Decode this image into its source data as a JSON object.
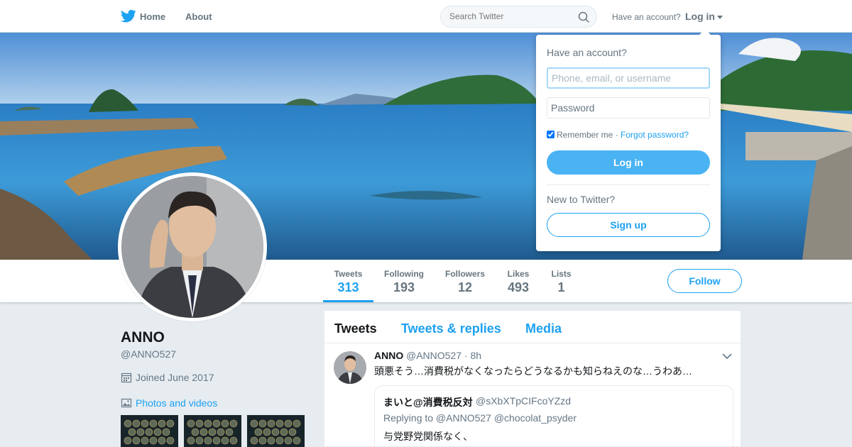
{
  "nav": {
    "home_label": "Home",
    "about_label": "About",
    "search_placeholder": "Search Twitter",
    "have_account": "Have an account?",
    "login_label": "Log in"
  },
  "profile": {
    "name": "ANNO",
    "handle": "@ANNO527",
    "joined": "Joined June 2017",
    "photos_link": "Photos and videos",
    "follow_label": "Follow",
    "stats": [
      {
        "label": "Tweets",
        "value": "313"
      },
      {
        "label": "Following",
        "value": "193"
      },
      {
        "label": "Followers",
        "value": "12"
      },
      {
        "label": "Likes",
        "value": "493"
      },
      {
        "label": "Lists",
        "value": "1"
      }
    ]
  },
  "timeline": {
    "tabs": [
      "Tweets",
      "Tweets & replies",
      "Media"
    ],
    "tweet": {
      "name": "ANNO",
      "meta": "@ANNO527 · 8h",
      "text": "頭悪そう…消費税がなくなったらどうなるかも知らねえのな…うわあ…",
      "quote": {
        "name": "まいと@消費税反対",
        "handle": "@sXbXTpCIFcoYZzd",
        "reply": "Replying to @ANNO527 @chocolat_psyder",
        "text": "与党野党関係なく、"
      }
    }
  },
  "login_dropdown": {
    "title": "Have an account?",
    "username_placeholder": "Phone, email, or username",
    "password_placeholder": "Password",
    "remember": "Remember me",
    "separator": " · ",
    "forgot": "Forgot password?",
    "login_button": "Log in",
    "new_user": "New to Twitter?",
    "signup_button": "Sign up"
  },
  "colors": {
    "brand": "#1da1f2",
    "muted": "#66757f",
    "background": "#e6ecf0"
  }
}
